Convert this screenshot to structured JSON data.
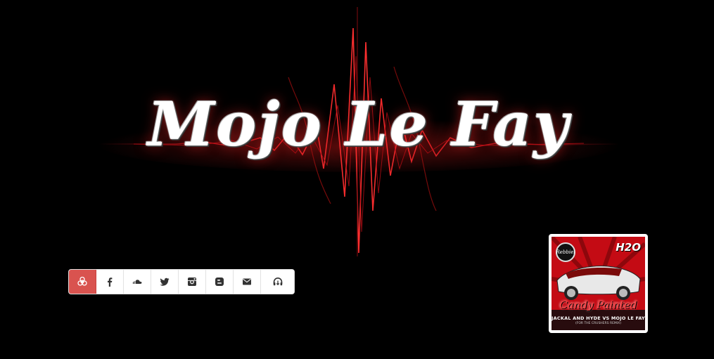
{
  "logo": {
    "text": "Mojo Le Fay",
    "accent_color": "#e0141e"
  },
  "social": {
    "items": [
      {
        "name": "biohazard",
        "icon": "biohazard-icon",
        "active": true
      },
      {
        "name": "facebook",
        "icon": "facebook-icon",
        "active": false
      },
      {
        "name": "soundcloud",
        "icon": "soundcloud-icon",
        "active": false
      },
      {
        "name": "twitter",
        "icon": "twitter-icon",
        "active": false
      },
      {
        "name": "instagram",
        "icon": "instagram-icon",
        "active": false
      },
      {
        "name": "blogger",
        "icon": "blogger-icon",
        "active": false
      },
      {
        "name": "email",
        "icon": "envelope-icon",
        "active": false
      },
      {
        "name": "download",
        "icon": "headphones-download-icon",
        "active": false
      }
    ],
    "active_color": "#d9534f"
  },
  "album": {
    "brand_left": "Rebbiel",
    "brand_right": "H2O",
    "title": "Candy Painted",
    "artists": "JACKAL AND HYDE VS MOJO LE FAY",
    "subtitle": "(FOR THE CRUSHERS REMIX)"
  }
}
